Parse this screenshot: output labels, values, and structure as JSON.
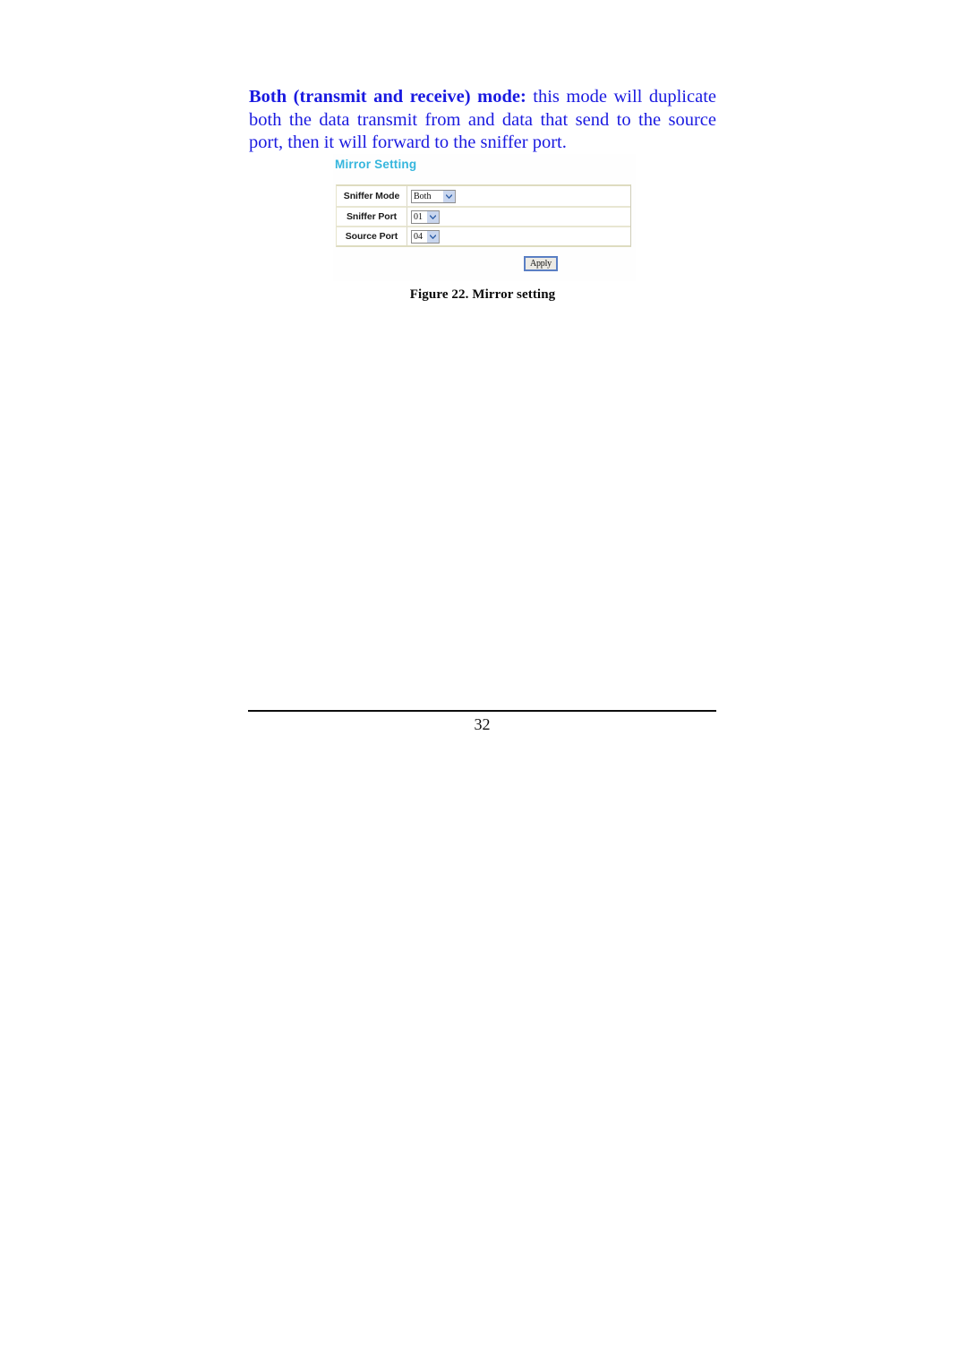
{
  "document": {
    "page_number": "32"
  },
  "body": {
    "paragraph": {
      "lead": "Both (transmit and receive) mode:",
      "rest": " this mode will duplicate both the data transmit from and data that send to the source port, then it will forward to the sniffer port.",
      "color": "#1a1ae0"
    }
  },
  "figure": {
    "caption": "Figure 22. Mirror setting",
    "panel": {
      "heading": "Mirror Setting",
      "heading_color": "#36b6dd",
      "rows": [
        {
          "label": "Sniffer Mode",
          "value": "Both",
          "width": "wide"
        },
        {
          "label": "Sniffer Port",
          "value": "01",
          "width": "narrow"
        },
        {
          "label": "Source Port",
          "value": "04",
          "width": "narrow"
        }
      ],
      "apply_label": "Apply",
      "apply_border_color": "#5a7fc4"
    }
  }
}
